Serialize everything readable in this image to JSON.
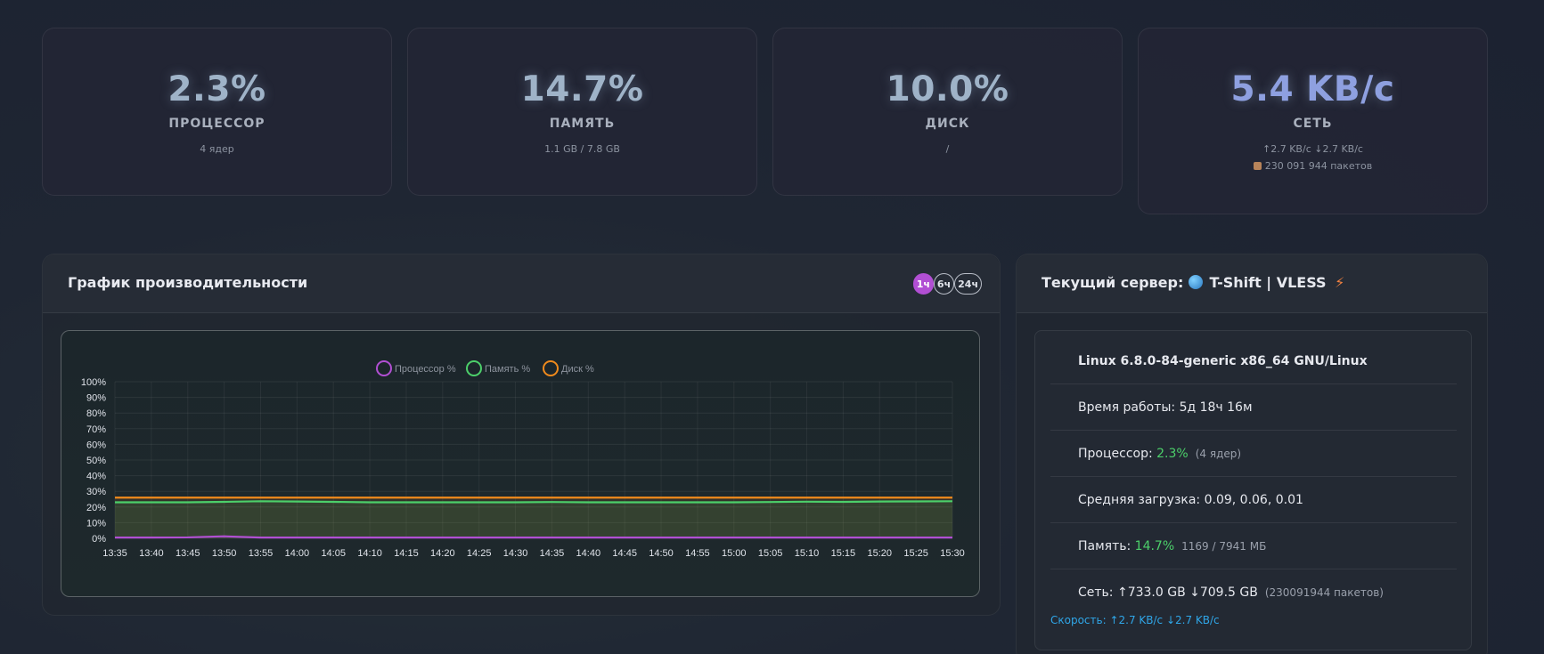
{
  "stats": {
    "cpu": {
      "value": "2.3%",
      "label": "ПРОЦЕССОР",
      "sub": "4 ядер"
    },
    "memory": {
      "value": "14.7%",
      "label": "ПАМЯТЬ",
      "sub": "1.1 GB / 7.8 GB"
    },
    "disk": {
      "value": "10.0%",
      "label": "ДИСК",
      "sub": "/"
    },
    "network": {
      "value": "5.4 KB/с",
      "label": "СЕТЬ",
      "sub": "↑2.7 KB/с ↓2.7 KB/с",
      "packets": "230 091 944 пакетов",
      "packets_icon": "package-icon"
    }
  },
  "performance": {
    "title": "График производительности",
    "ranges": [
      "1ч",
      "6ч",
      "24ч"
    ],
    "active_range": "1ч"
  },
  "server": {
    "title_prefix": "Текущий сервер:",
    "name": "T-Shift | VLESS",
    "icons": [
      "globe-icon",
      "lightning-icon"
    ],
    "os": "Linux 6.8.0-84-generic x86_64 GNU/Linux",
    "uptime": "Время работы: 5д 18ч 16м",
    "cpu_label": "Процессор:",
    "cpu_value": "2.3%",
    "cpu_cores": "(4 ядер)",
    "load": "Средняя загрузка: 0.09, 0.06, 0.01",
    "mem_label": "Память:",
    "mem_value": "14.7%",
    "mem_detail": "1169 / 7941 МБ",
    "net": "Сеть: ↑733.0 GB ↓709.5 GB",
    "net_packets": "(230091944 пакетов)",
    "speed": "Скорость: ↑2.7 KB/с ↓2.7 KB/с"
  },
  "chart_data": {
    "type": "line",
    "categories": [
      "13:35",
      "13:40",
      "13:45",
      "13:50",
      "13:55",
      "14:00",
      "14:05",
      "14:10",
      "14:15",
      "14:20",
      "14:25",
      "14:30",
      "14:35",
      "14:40",
      "14:45",
      "14:50",
      "14:55",
      "15:00",
      "15:05",
      "15:10",
      "15:15",
      "15:20",
      "15:25",
      "15:30"
    ],
    "ylim": [
      0,
      100
    ],
    "yticks": [
      "0%",
      "10%",
      "20%",
      "30%",
      "40%",
      "50%",
      "60%",
      "70%",
      "80%",
      "90%",
      "100%"
    ],
    "legend_position": "top",
    "grid": true,
    "series": [
      {
        "name": "Процессор %",
        "color": "#b14fd3",
        "values": [
          0.5,
          0.5,
          0.6,
          1.3,
          0.5,
          0.5,
          0.5,
          0.5,
          0.5,
          0.5,
          0.5,
          0.5,
          0.5,
          0.5,
          0.5,
          0.5,
          0.5,
          0.5,
          0.5,
          0.5,
          0.5,
          0.5,
          0.5,
          0.5
        ]
      },
      {
        "name": "Память %",
        "color": "#4ccf6a",
        "values": [
          23,
          23,
          23,
          23.3,
          23.7,
          23.5,
          23.3,
          23,
          23,
          23,
          23,
          23,
          23.2,
          23,
          23,
          23,
          23,
          23,
          23.2,
          23.4,
          23.3,
          23.5,
          23.6,
          23.7
        ]
      },
      {
        "name": "Диск %",
        "color": "#f08a1c",
        "values": [
          26,
          26,
          26,
          26,
          26,
          26,
          26,
          26,
          26,
          26,
          26,
          26,
          26,
          26,
          26,
          26,
          26,
          26,
          26,
          26,
          26,
          26,
          26,
          26
        ]
      }
    ]
  }
}
